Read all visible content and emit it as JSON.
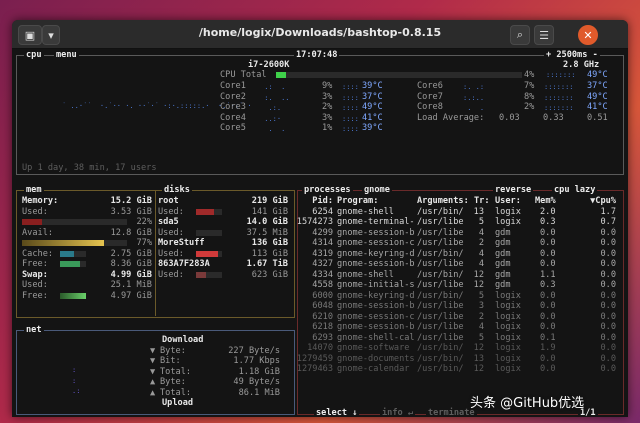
{
  "window": {
    "title": "/home/logix/Downloads/bashtop-0.8.15"
  },
  "icons": {
    "terminal": "terminal-icon",
    "dropdown": "chevron-down-icon",
    "search": "search-icon",
    "menu": "hamburger-icon",
    "close": "close-icon"
  },
  "cpu": {
    "label": "cpu",
    "menu": "menu",
    "clock": "17:07:48",
    "interval": "+ 2500ms -",
    "model": "i7-2600K",
    "freq": "2.8 GHz",
    "total_label": "CPU Total",
    "total_pct": "4%",
    "total_temp": "49°C",
    "cores_left": [
      {
        "name": "Core1",
        "pct": "9%",
        "temp": "39°C"
      },
      {
        "name": "Core2",
        "pct": "3%",
        "temp": "37°C"
      },
      {
        "name": "Core3",
        "pct": "2%",
        "temp": "49°C"
      },
      {
        "name": "Core4",
        "pct": "3%",
        "temp": "41°C"
      },
      {
        "name": "Core5",
        "pct": "1%",
        "temp": "39°C"
      }
    ],
    "cores_right": [
      {
        "name": "Core6",
        "pct": "7%",
        "temp": "37°C"
      },
      {
        "name": "Core7",
        "pct": "8%",
        "temp": "49°C"
      },
      {
        "name": "Core8",
        "pct": "2%",
        "temp": "41°C"
      }
    ],
    "load_label": "Load Average:",
    "load": [
      "0.03",
      "0.33",
      "0.51"
    ],
    "uptime": "Up 1 day, 38 min, 17 users"
  },
  "mem": {
    "label": "mem",
    "memory_label": "Memory:",
    "memory_val": "15.2 GiB",
    "used_label": "Used:",
    "used_val": "3.53 GiB",
    "used_pct": "22%",
    "avail_label": "Avail:",
    "avail_val": "12.8 GiB",
    "avail_pct": "77%",
    "cache_label": "Cache:",
    "cache_val": "2.75 GiB",
    "free_label": "Free:",
    "free_val": "8.36 GiB",
    "swap_label": "Swap:",
    "swap_val": "4.99 GiB",
    "swap_used_label": "Used:",
    "swap_used_val": "25.1 MiB",
    "swap_free_label": "Free:",
    "swap_free_val": "4.97 GiB"
  },
  "disks": {
    "label": "disks",
    "items": [
      {
        "name": "root",
        "total": "219 GiB",
        "used_label": "Used:",
        "used": "141 GiB"
      },
      {
        "name": "sda5",
        "total": "14.0 GiB",
        "used_label": "Used:",
        "used": "37.5 MiB"
      },
      {
        "name": "MoreStuff",
        "total": "136 GiB",
        "used_label": "Used:",
        "used": "113 GiB"
      },
      {
        "name": "863A7F283A",
        "total": "1.67 TiB",
        "used_label": "Used:",
        "used": "623 GiB"
      }
    ]
  },
  "net": {
    "label": "net",
    "download_label": "Download",
    "upload_label": "Upload",
    "rows": [
      {
        "arrow": "▼",
        "label": "Byte:",
        "val": "227 Byte/s"
      },
      {
        "arrow": "▼",
        "label": "Bit:",
        "val": "1.77 Kbps"
      },
      {
        "arrow": "▼",
        "label": "Total:",
        "val": "1.18 GiB"
      },
      {
        "arrow": "▲",
        "label": "Byte:",
        "val": "49 Byte/s"
      },
      {
        "arrow": "▲",
        "label": "Total:",
        "val": "86.1 MiB"
      }
    ]
  },
  "proc": {
    "label": "processes",
    "filter": "gnome",
    "reverse": "reverse",
    "sort": "cpu lazy",
    "headers": {
      "pid": "Pid:",
      "program": "Program:",
      "args": "Arguments:",
      "tr": "Tr:",
      "user": "User:",
      "mem": "Mem%",
      "cpu": "▼Cpu%"
    },
    "rows": [
      {
        "pid": "6254",
        "prog": "gnome-shell",
        "args": "/usr/bin/",
        "tr": "13",
        "user": "logix",
        "mem": "2.0",
        "cpu": "1.7"
      },
      {
        "pid": "1574273",
        "prog": "gnome-terminal-",
        "args": "/usr/libe",
        "tr": "5",
        "user": "logix",
        "mem": "0.3",
        "cpu": "0.7"
      },
      {
        "pid": "4299",
        "prog": "gnome-session-b",
        "args": "/usr/libe",
        "tr": "4",
        "user": "gdm",
        "mem": "0.0",
        "cpu": "0.0"
      },
      {
        "pid": "4314",
        "prog": "gnome-session-c",
        "args": "/usr/libe",
        "tr": "2",
        "user": "gdm",
        "mem": "0.0",
        "cpu": "0.0"
      },
      {
        "pid": "4319",
        "prog": "gnome-keyring-d",
        "args": "/usr/bin/",
        "tr": "4",
        "user": "gdm",
        "mem": "0.0",
        "cpu": "0.0"
      },
      {
        "pid": "4327",
        "prog": "gnome-session-b",
        "args": "/usr/libe",
        "tr": "4",
        "user": "gdm",
        "mem": "0.0",
        "cpu": "0.0"
      },
      {
        "pid": "4334",
        "prog": "gnome-shell",
        "args": "/usr/bin/",
        "tr": "12",
        "user": "gdm",
        "mem": "1.1",
        "cpu": "0.0"
      },
      {
        "pid": "4558",
        "prog": "gnome-initial-s",
        "args": "/usr/libe",
        "tr": "12",
        "user": "gdm",
        "mem": "0.3",
        "cpu": "0.0"
      },
      {
        "pid": "6000",
        "prog": "gnome-keyring-d",
        "args": "/usr/bin/",
        "tr": "5",
        "user": "logix",
        "mem": "0.0",
        "cpu": "0.0"
      },
      {
        "pid": "6048",
        "prog": "gnome-session-b",
        "args": "/usr/libe",
        "tr": "3",
        "user": "logix",
        "mem": "0.0",
        "cpu": "0.0"
      },
      {
        "pid": "6210",
        "prog": "gnome-session-c",
        "args": "/usr/libe",
        "tr": "2",
        "user": "logix",
        "mem": "0.0",
        "cpu": "0.0"
      },
      {
        "pid": "6218",
        "prog": "gnome-session-b",
        "args": "/usr/libe",
        "tr": "4",
        "user": "logix",
        "mem": "0.0",
        "cpu": "0.0"
      },
      {
        "pid": "6293",
        "prog": "gnome-shell-cal",
        "args": "/usr/libe",
        "tr": "5",
        "user": "logix",
        "mem": "0.1",
        "cpu": "0.0"
      },
      {
        "pid": "14070",
        "prog": "gnome-software",
        "args": "/usr/bin/",
        "tr": "12",
        "user": "logix",
        "mem": "1.9",
        "cpu": "0.0"
      },
      {
        "pid": "1279459",
        "prog": "gnome-documents",
        "args": "/usr/bin/",
        "tr": "13",
        "user": "logix",
        "mem": "0.0",
        "cpu": "0.0"
      },
      {
        "pid": "1279463",
        "prog": "gnome-calendar",
        "args": "/usr/bin/",
        "tr": "12",
        "user": "logix",
        "mem": "0.0",
        "cpu": "0.0"
      }
    ],
    "footer_select": "select ↓",
    "footer_info": "info ↵",
    "footer_terminate": "terminate",
    "footer_page": "1/1"
  },
  "watermark": "头条 @GitHub优选",
  "colors": {
    "accent_close": "#e05a2b",
    "bar_green": "#3fd14a",
    "bar_red": "#e23b3b",
    "bar_yellow": "#e6c450",
    "text_blue": "#7fa8ff"
  }
}
